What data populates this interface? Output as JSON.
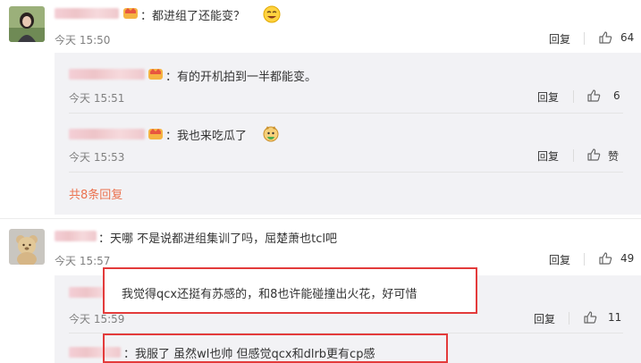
{
  "comments": [
    {
      "text": "：都进组了还能变？",
      "time": "今天 15:50",
      "reply_label": "回复",
      "likes": "64",
      "replies": [
        {
          "text": "：有的开机拍到一半都能变。",
          "time": "今天 15:51",
          "reply_label": "回复",
          "likes": "6"
        },
        {
          "text": "：我也来吃瓜了",
          "time": "今天 15:53",
          "reply_label": "回复",
          "likes": "赞"
        }
      ],
      "more_replies": "共8条回复"
    },
    {
      "text": "：天哪 不是说都进组集训了吗，屈楚萧也tcl吧",
      "time": "今天 15:57",
      "reply_label": "回复",
      "likes": "49",
      "replies": [
        {
          "text": "我觉得qcx还挺有苏感的，和8也许能碰撞出火花，好可惜",
          "time": "今天 15:59",
          "reply_label": "回复",
          "likes": "11"
        },
        {
          "text": "：我服了 虽然wl也帅 但感觉qcx和dlrb更有cp感"
        }
      ]
    }
  ],
  "colors": {
    "link": "#eb7350",
    "highlight": "#e33b3b",
    "reply_bg": "#f2f2f5"
  }
}
